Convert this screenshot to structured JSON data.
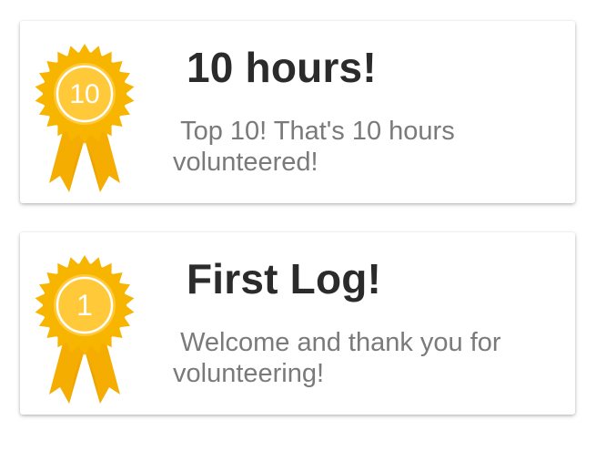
{
  "achievements": [
    {
      "badge_number": "10",
      "title": "10 hours!",
      "description": " Top 10! That's 10 hours volunteered!",
      "icon": "rosette-medal-icon"
    },
    {
      "badge_number": "1",
      "title": "First Log!",
      "description": " Welcome and thank you for volunteering!",
      "icon": "rosette-medal-icon"
    }
  ],
  "colors": {
    "medal_gold": "#f7b500",
    "medal_light": "#ffc93a",
    "ribbon": "#f4ad00",
    "title_text": "#2b2b2b",
    "description_text": "#7a7a7a"
  }
}
